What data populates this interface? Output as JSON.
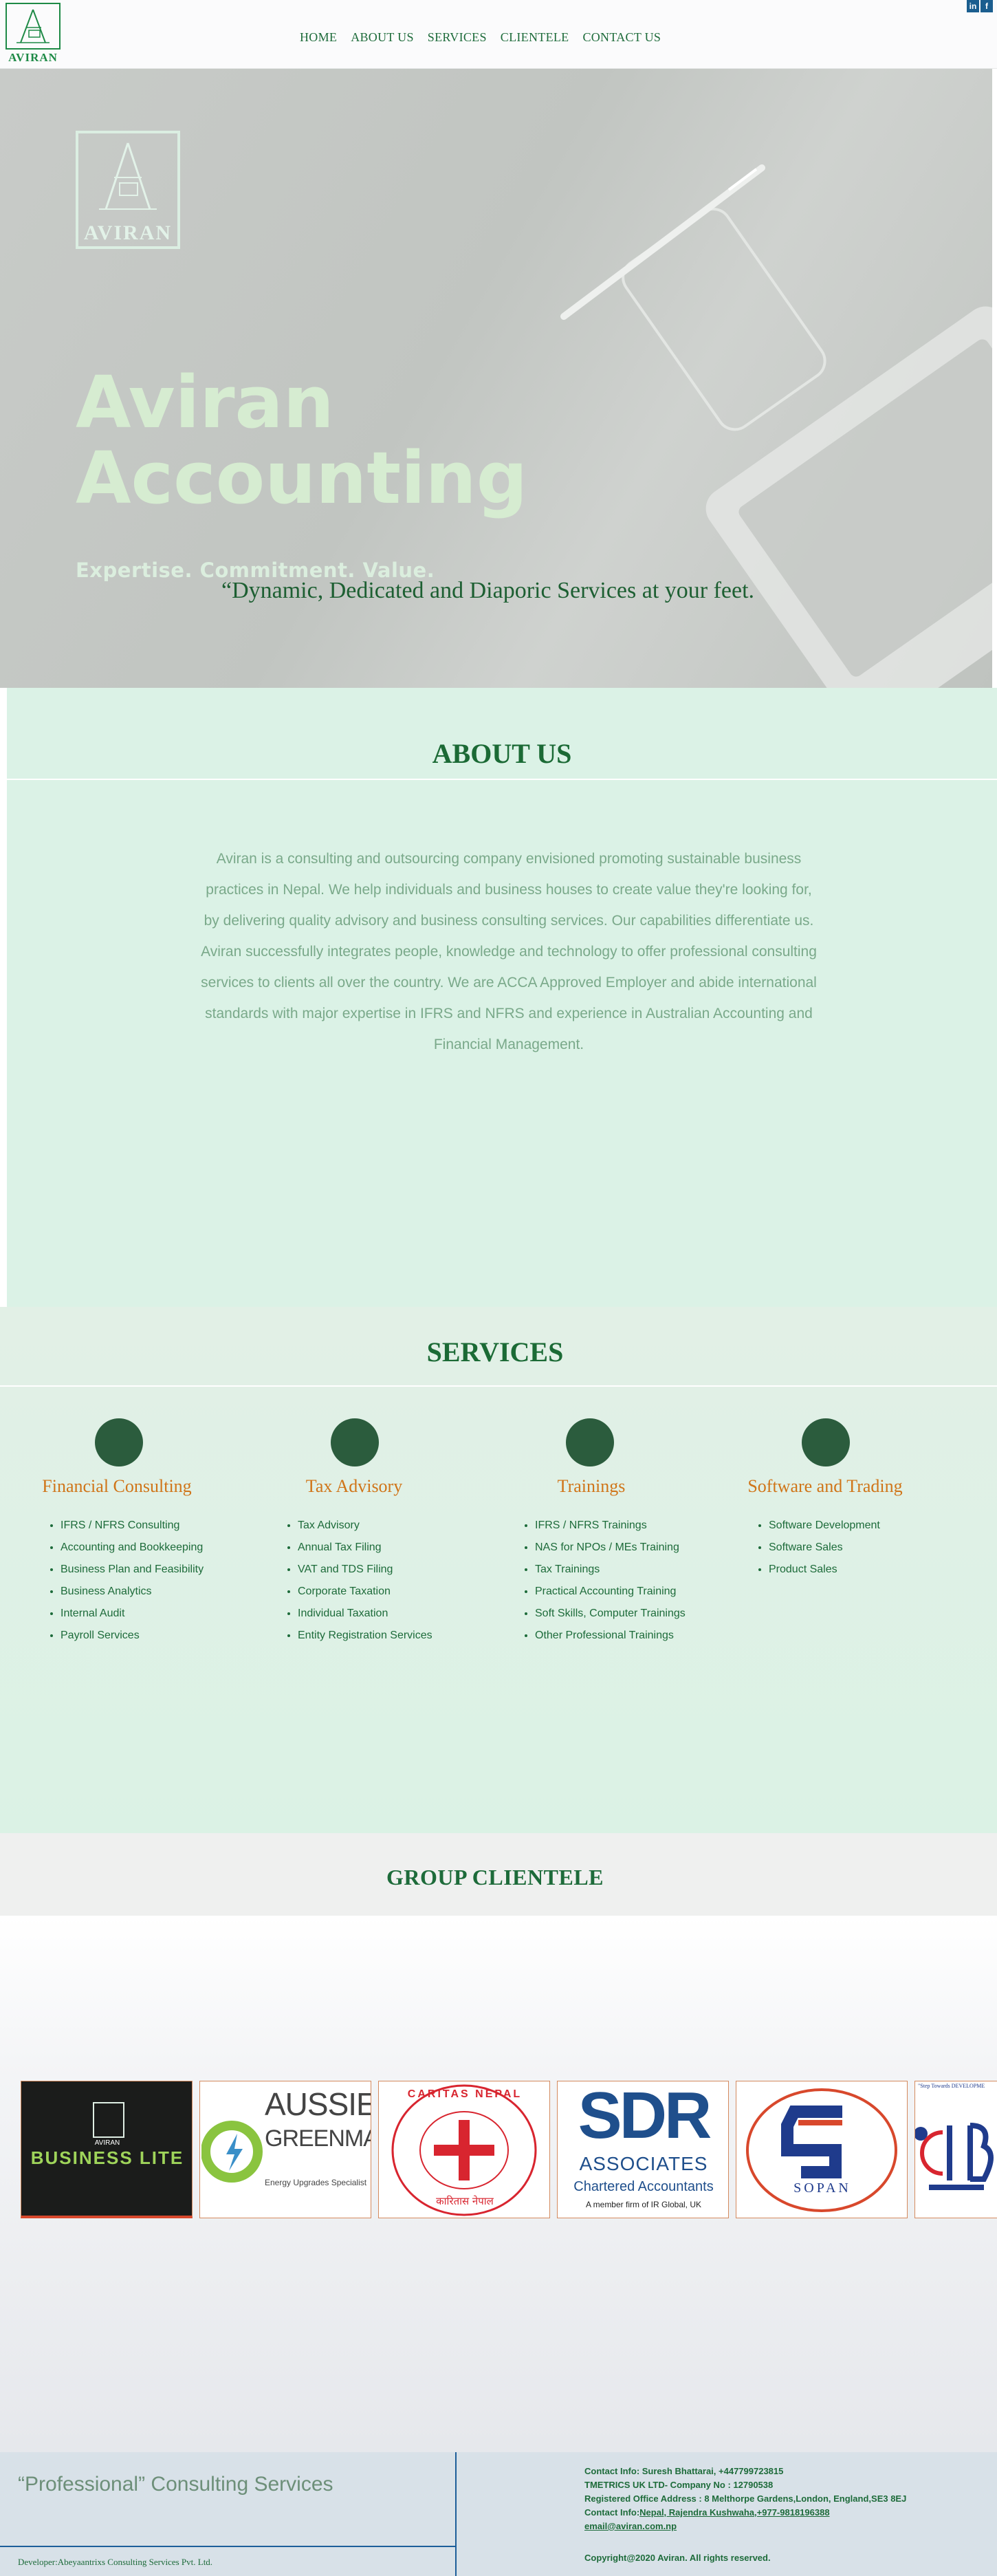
{
  "header": {
    "logo_text": "AVIRAN",
    "nav": [
      "HOME",
      "ABOUT US",
      "SERVICES",
      "CLIENTELE",
      "CONTACT US"
    ],
    "social": [
      {
        "icon": "linkedin-icon",
        "glyph": "in"
      },
      {
        "icon": "facebook-icon",
        "glyph": "f"
      }
    ]
  },
  "hero": {
    "emblem_text": "AVIRAN",
    "title_line1": "Aviran",
    "title_line2": "Accounting",
    "tagline": "Expertise. Commitment. Value.",
    "quote": "“Dynamic, Dedicated and Diaporic Services at your feet."
  },
  "about": {
    "title": "ABOUT US",
    "body": "Aviran is a consulting and outsourcing company envisioned promoting sustainable business practices in Nepal. We help individuals and business houses to create value they're looking for, by delivering quality advisory and business consulting services. Our capabilities differentiate us. Aviran successfully integrates people, knowledge and technology to offer professional consulting services to clients all over the country. We are ACCA Approved Employer and abide international standards with major expertise in IFRS and NFRS and experience in Australian Accounting and Financial Management."
  },
  "services": {
    "title": "SERVICES",
    "columns": [
      {
        "heading": "Financial Consulting",
        "items": [
          "IFRS / NFRS Consulting",
          "Accounting and Bookkeeping",
          "Business Plan and Feasibility",
          "Business Analytics",
          "Internal Audit",
          "Payroll Services"
        ]
      },
      {
        "heading": "Tax Advisory",
        "items": [
          "Tax Advisory",
          "Annual Tax Filing",
          "VAT and TDS Filing",
          "Corporate Taxation",
          "Individual Taxation",
          "Entity Registration Services"
        ]
      },
      {
        "heading": "Trainings",
        "items": [
          "IFRS / NFRS Trainings",
          "NAS for NPOs / MEs Training",
          "Tax Trainings",
          "Practical Accounting Training",
          "Soft Skills, Computer Trainings",
          "Other Professional Trainings"
        ]
      },
      {
        "heading": "Software and Trading",
        "items": [
          "Software Development",
          "Software Sales",
          "Product Sales"
        ]
      }
    ]
  },
  "clientele": {
    "title": "GROUP CLIENTELE",
    "logos": [
      {
        "name": "business-lite",
        "small": "AVIRAN",
        "text": "BUSINESS LITE"
      },
      {
        "name": "aussie-greenmarks",
        "line1": "AUSSIE",
        "line2": "GREENMARKS",
        "line3": "Energy Upgrades Specialist"
      },
      {
        "name": "caritas-nepal",
        "arc": "CARITAS NEPAL",
        "bottom": "कारितास नेपाल"
      },
      {
        "name": "sdr-associates",
        "big": "SDR",
        "line1": "ASSOCIATES",
        "line2": "Chartered Accountants",
        "line3": "A member firm of IR Global, UK"
      },
      {
        "name": "sopan",
        "text": "SOPAN"
      },
      {
        "name": "ctb-partial",
        "text": "\"Step Towards DEVELOPME"
      }
    ]
  },
  "footer": {
    "tagline": "“Professional” Consulting Services",
    "developer": "Developer:Abeyaantrixs Consulting Services Pvt. Ltd.",
    "contact1": "Contact Info: Suresh Bhattarai, +447799723815",
    "company": "TMETRICS UK LTD- Company No : 12790538",
    "address": "Registered Office Address : 8 Melthorpe Gardens,London, England,SE3 8EJ",
    "contact2_label": "Contact Info:",
    "contact2_value": "Nepal, Rajendra Kushwaha,+977-9818196388",
    "email": "email@aviran.com.np",
    "copyright": "Copyright@2020 Aviran. All rights reserved."
  }
}
